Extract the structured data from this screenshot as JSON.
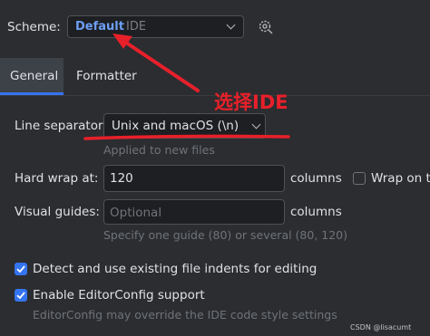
{
  "scheme": {
    "label": "Scheme:",
    "value_primary": "Default",
    "value_secondary": "IDE"
  },
  "tabs": [
    {
      "label": "General",
      "active": true
    },
    {
      "label": "Formatter",
      "active": false
    }
  ],
  "line_separator": {
    "label": "Line separator:",
    "value": "Unix and macOS (\\n)",
    "hint": "Applied to new files"
  },
  "hard_wrap": {
    "label": "Hard wrap at:",
    "value": "120",
    "unit": "columns",
    "wrap_label": "Wrap on ty"
  },
  "visual_guides": {
    "label": "Visual guides:",
    "placeholder": "Optional",
    "unit": "columns",
    "hint": "Specify one guide (80) or several (80, 120)"
  },
  "detect_indents": {
    "label": "Detect and use existing file indents for editing",
    "checked": true
  },
  "editorconfig": {
    "label": "Enable EditorConfig support",
    "checked": true,
    "hint": "EditorConfig may override the IDE code style settings"
  },
  "annotation": {
    "text": "选择IDE",
    "color": "#e8202a"
  },
  "watermark": "CSDN @lisacumt",
  "colors": {
    "background": "#2b2d30",
    "accent": "#3574f0",
    "link": "#6c9ff5"
  }
}
